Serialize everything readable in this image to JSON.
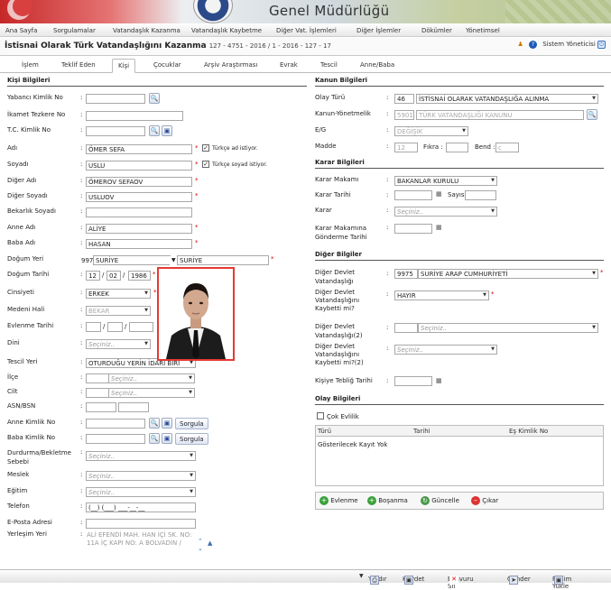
{
  "banner": {
    "title": "Genel Müdürlüğü"
  },
  "menu": [
    "Ana Sayfa",
    "Sorgulamalar",
    "Vatandaşlık Kazanma",
    "Vatandaşlık Kaybetme",
    "Diğer Vat. İşlemleri",
    "Diğer İşlemler",
    "Dökümler",
    "Yönetimsel"
  ],
  "header": {
    "title": "İstisnai Olarak Türk Vatandaşlığını Kazanma",
    "sub": "127 - 4751 - 2016 / 1 - 2016 - 127 - 17",
    "user": "Sistem Yöneticisi"
  },
  "tabs": [
    "İşlem",
    "Teklif Eden",
    "Kişi",
    "Çocuklar",
    "Arşiv Araştırması",
    "Evrak",
    "Tescil",
    "Anne/Baba"
  ],
  "left": {
    "section": "Kişi Bilgileri",
    "labels": [
      "Yabancı Kimlik No",
      "İkamet Tezkere No",
      "T.C. Kimlik No",
      "Adı",
      "Soyadı",
      "Diğer Adı",
      "Diğer Soyadı",
      "Bekarlık Soyadı",
      "Anne Adı",
      "Baba Adı",
      "Doğum Yeri",
      "Doğum Tarihi",
      "Cinsiyeti",
      "Medeni Hali",
      "Evlenme Tarihi",
      "Dini",
      "Tescil Yeri",
      "İlçe",
      "Cilt",
      "ASN/BSN",
      "Anne Kimlik No",
      "Baba Kimlik No",
      "Durdurma/Bekletme Sebebi",
      "Meslek",
      "Eğitim",
      "Telefon",
      "E-Posta Adresi",
      "Yerleşim Yeri"
    ],
    "ad": "ÖMER SEFA",
    "soyad": "USLU",
    "diger_ad": "ÖMEROV SEFAOV",
    "diger_soyad": "USLUOV",
    "anne": "ALİYE",
    "baba": "HASAN",
    "dogum_yeri_kod": "9975",
    "dogum_yeri": "SURİYE",
    "dogum_yeri2": "SURİYE",
    "gun": "12",
    "ay": "02",
    "yil": "1986",
    "cinsiyet": "ERKEK",
    "medeni": "BEKAR",
    "turkce_ad": "Türkçe ad istiyor.",
    "turkce_soyad": "Türkçe soyad istiyor.",
    "seciniz": "Seçiniz..",
    "sorgula": "Sorgula",
    "tescil": "OTURDUĞU YERİN İDARİ BİRİ",
    "telefon": "(__) (___) ___-__-__",
    "yerlesim": "ALİ EFENDİ MAH. HAN İÇİ SK. NO: 11A İÇ KAPI NO: A BOLVADİN /"
  },
  "right": {
    "kanun_section": "Kanun Bilgileri",
    "olay_turu_lbl": "Olay Türü",
    "olay_kod": "46",
    "olay": "İSTİSNAİ OLARAK VATANDAŞLIĞA ALINMA",
    "kanun_lbl": "Kanun-Yönetmelik",
    "kanun_kod": "5901",
    "kanun": "TÜRK VATANDAŞLIĞI KANUNU",
    "eg_lbl": "E/G",
    "eg": "DEĞİŞİK",
    "madde_lbl": "Madde",
    "madde": "12",
    "fikra_lbl": "Fıkra :",
    "bend_lbl": "Bend :",
    "bend": "c",
    "karar_section": "Karar Bilgileri",
    "makam_lbl": "Karar Makamı",
    "makam": "BAKANLAR KURULU",
    "tarih_lbl": "Karar Tarihi",
    "sayi_lbl": "Sayısı",
    "karar_lbl": "Karar",
    "seciniz": "Seçiniz..",
    "gonderme_lbl": "Karar Makamına Gönderme Tarihi",
    "diger_section": "Diğer Bilgiler",
    "dv_lbl": "Diğer Devlet Vatandaşlığı",
    "dv_kod": "9975",
    "dv": "SURİYE ARAP CUMHURİYETİ",
    "dvk_lbl": "Diğer Devlet Vatandaşlığını Kaybetti mi?",
    "dvk": "HAYIR",
    "dv2_lbl": "Diğer Devlet Vatandaşlığı(2)",
    "dvk2_lbl": "Diğer Devlet Vatandaşlığını Kaybetti mi?(2)",
    "teblig_lbl": "Kişiye Tebliğ Tarihi",
    "olay_section": "Olay Bilgileri",
    "cok_evlilik": "Çok Evlilik",
    "grid_cols": [
      "Türü",
      "Tarihi",
      "Eş Kimlik No"
    ],
    "grid_empty": "Gösterilecek Kayıt Yok",
    "buttons": [
      "Evlenme",
      "Boşanma",
      "Güncelle",
      "Çıkar"
    ]
  },
  "footer": [
    "Yazdır",
    "Kaydet",
    "Başvuru Sil",
    "Gönder",
    "Resim Yükle"
  ]
}
